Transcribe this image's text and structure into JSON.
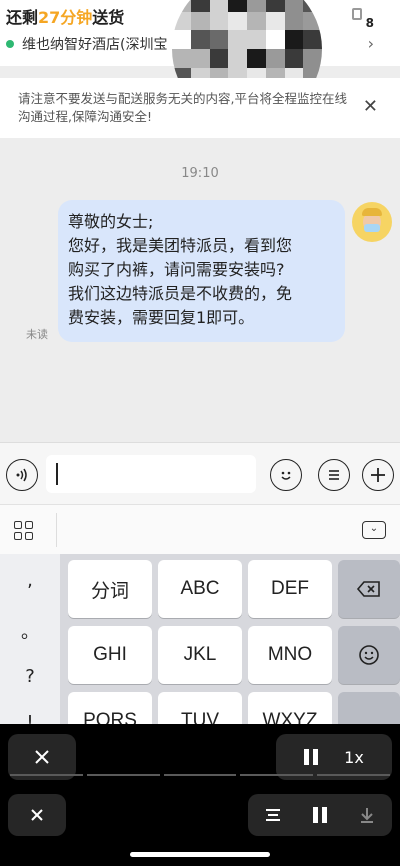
{
  "order": {
    "status_prefix": "还剩",
    "time_left": "27分钟",
    "status_suffix": "送货",
    "store": "维也纳智好酒店(深圳宝",
    "badge": "8"
  },
  "notice": {
    "text": "请注意不要发送与配送服务无关的内容,平台将全程监控在线沟通过程,保障沟通安全!"
  },
  "chat": {
    "timestamp": "19:10",
    "message_lines": [
      "尊敬的女士;",
      "您好，我是美团特派员，看到您",
      "购买了内裤，请问需要安装吗?",
      "我们这边特派员是不收费的，免",
      "费安装，需要回复1即可。"
    ],
    "read_status": "未读"
  },
  "keyboard": {
    "punct": [
      ",",
      "。",
      "?",
      "!"
    ],
    "row1": [
      "分词",
      "ABC",
      "DEF"
    ],
    "row2": [
      "GHI",
      "JKL",
      "MNO"
    ],
    "row3": [
      "PQRS",
      "TUV",
      "WXYZ"
    ]
  },
  "player": {
    "speed": "1x"
  },
  "colors": {
    "accent_time": "#f5a623",
    "bubble": "#d9e6fb",
    "store_dot": "#2eb872"
  }
}
